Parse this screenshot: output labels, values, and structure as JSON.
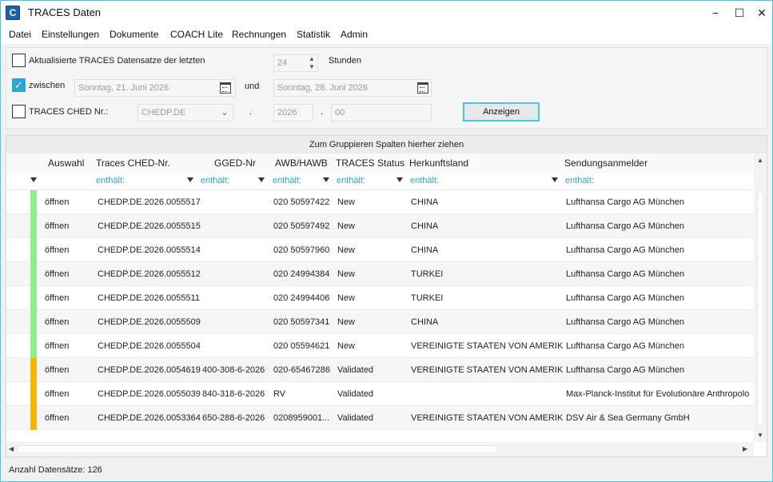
{
  "window": {
    "app_icon": "C",
    "title": "TRACES Daten",
    "minimize": "−",
    "maximize": "☐",
    "close": "✕"
  },
  "menu": [
    "Datei",
    "Einstellungen",
    "Dokumente",
    "COACH Lite",
    "Rechnungen",
    "Statistik",
    "Admin"
  ],
  "filters": {
    "updated_label": "Aktualisierte TRACES Datensatze  der letzten",
    "hours_value": "24",
    "hours_unit": "Stunden",
    "between_label": "zwischen",
    "date_from": "Sonntag, 21. Juni 2026",
    "and_label": "und",
    "date_to": "Sonntag, 28. Juni 2026",
    "ched_label": "TRACES CHED Nr.:",
    "ched_prefix": "CHEDP.DE",
    "dot1": ".",
    "ched_year": "2026",
    "dot2": ".",
    "ched_number": "00",
    "show_button": "Anzeigen",
    "updated_checked": false,
    "between_checked": true,
    "ched_checked": false
  },
  "grid": {
    "group_hint": "Zum Gruppieren Spalten hierher ziehen",
    "columns": [
      "Auswahl",
      "Traces CHED-Nr.",
      "GGED-Nr",
      "AWB/HAWB",
      "TRACES Status",
      "Herkunftsland",
      "Sendungsanmelder"
    ],
    "filter_text": "enthält:",
    "status_colors": {
      "New": "#90ee90",
      "Validated": "#f5b800"
    },
    "rows": [
      {
        "auswahl": "öffnen",
        "ched": "CHEDP.DE.2026.0055517",
        "gged": "",
        "awb": "020 50597422",
        "status": "New",
        "land": "CHINA",
        "anmelder": "Lufthansa Cargo AG München"
      },
      {
        "auswahl": "öffnen",
        "ched": "CHEDP.DE.2026.0055515",
        "gged": "",
        "awb": "020 50597492",
        "status": "New",
        "land": "CHINA",
        "anmelder": "Lufthansa Cargo AG München"
      },
      {
        "auswahl": "öffnen",
        "ched": "CHEDP.DE.2026.0055514",
        "gged": "",
        "awb": "020 50597960",
        "status": "New",
        "land": "CHINA",
        "anmelder": "Lufthansa Cargo AG München"
      },
      {
        "auswahl": "öffnen",
        "ched": "CHEDP.DE.2026.0055512",
        "gged": "",
        "awb": "020 24994384",
        "status": "New",
        "land": "TURKEI",
        "anmelder": "Lufthansa Cargo AG München"
      },
      {
        "auswahl": "öffnen",
        "ched": "CHEDP.DE.2026.0055511",
        "gged": "",
        "awb": "020 24994406",
        "status": "New",
        "land": "TURKEI",
        "anmelder": "Lufthansa Cargo AG München"
      },
      {
        "auswahl": "öffnen",
        "ched": "CHEDP.DE.2026.0055509",
        "gged": "",
        "awb": "020 50597341",
        "status": "New",
        "land": "CHINA",
        "anmelder": "Lufthansa Cargo AG München"
      },
      {
        "auswahl": "öffnen",
        "ched": "CHEDP.DE.2026.0055504",
        "gged": "",
        "awb": "020 05594621",
        "status": "New",
        "land": "VEREINIGTE STAATEN VON AMERIKA",
        "anmelder": "Lufthansa Cargo AG München"
      },
      {
        "auswahl": "öffnen",
        "ched": "CHEDP.DE.2026.0054619",
        "gged": "400-308-6-2026",
        "awb": "020-65467286",
        "status": "Validated",
        "land": "VEREINIGTE STAATEN VON AMERIKA",
        "anmelder": "Lufthansa Cargo AG München"
      },
      {
        "auswahl": "öffnen",
        "ched": "CHEDP.DE.2026.0055039",
        "gged": "840-318-6-2026",
        "awb": "RV",
        "status": "Validated",
        "land": "",
        "anmelder": "Max-Planck-Institut für Evolutionäre Anthropolo"
      },
      {
        "auswahl": "öffnen",
        "ched": "CHEDP.DE.2026.0053364",
        "gged": "650-288-6-2026",
        "awb": "0208959001...",
        "status": "Validated",
        "land": "VEREINIGTE STAATEN VON AMERIKA",
        "anmelder": "DSV Air & Sea Germany GmbH"
      }
    ]
  },
  "status_bar": "Anzahl Datensätze: 126"
}
